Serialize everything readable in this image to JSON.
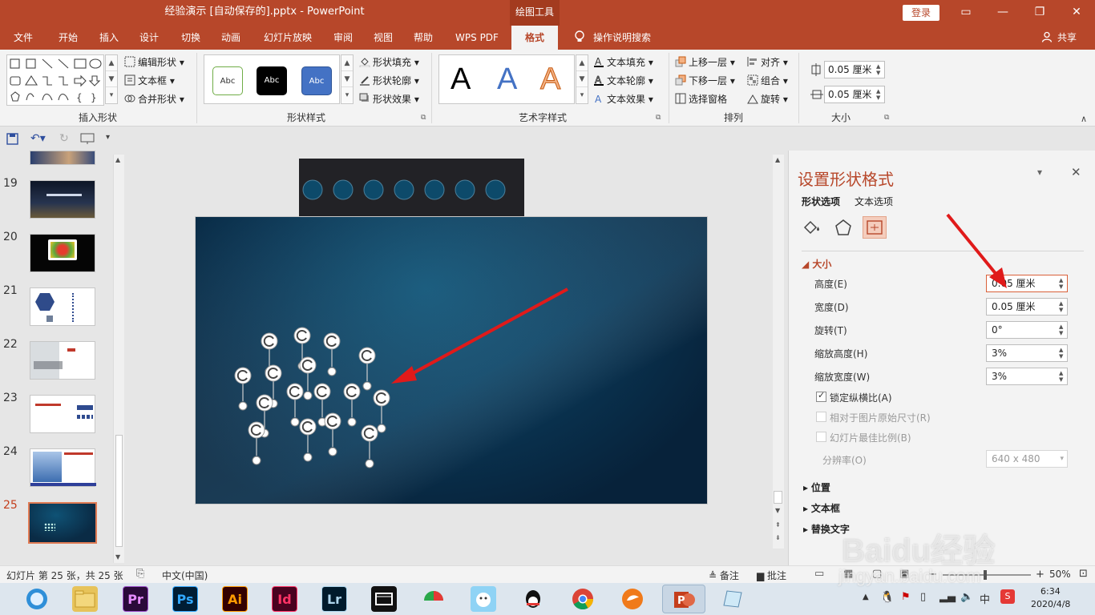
{
  "window": {
    "title": "经验演示 [自动保存的].pptx  -  PowerPoint",
    "context_group": "绘图工具",
    "login_label": "登录",
    "share_label": "共享",
    "tell_me": "操作说明搜索"
  },
  "tabs": [
    "文件",
    "开始",
    "插入",
    "设计",
    "切换",
    "动画",
    "幻灯片放映",
    "审阅",
    "视图",
    "帮助",
    "WPS PDF",
    "格式"
  ],
  "active_tab": "格式",
  "ribbon": {
    "insert_shapes": {
      "label": "插入形状",
      "edit_shape": "编辑形状",
      "text_box": "文本框",
      "merge_shapes": "合并形状"
    },
    "shape_styles": {
      "label": "形状样式",
      "presets": [
        "Abc",
        "Abc",
        "Abc"
      ],
      "fill": "形状填充",
      "outline": "形状轮廓",
      "effects": "形状效果"
    },
    "wordart": {
      "label": "艺术字样式",
      "presets": [
        "A",
        "A",
        "A"
      ],
      "text_fill": "文本填充",
      "text_outline": "文本轮廓",
      "text_effects": "文本效果"
    },
    "arrange": {
      "label": "排列",
      "bring_forward": "上移一层",
      "send_backward": "下移一层",
      "selection_pane": "选择窗格",
      "align": "对齐",
      "group": "组合",
      "rotate": "旋转"
    },
    "size": {
      "label": "大小",
      "height": "0.05 厘米",
      "width": "0.05 厘米"
    }
  },
  "slides": {
    "visible_numbers": [
      "19",
      "20",
      "21",
      "22",
      "23",
      "24",
      "25"
    ],
    "current": "25"
  },
  "format_pane": {
    "title": "设置形状格式",
    "tabs": [
      "形状选项",
      "文本选项"
    ],
    "section_size": "大小",
    "height_label": "高度(E)",
    "height_value": "0.05 厘米",
    "width_label": "宽度(D)",
    "width_value": "0.05 厘米",
    "rotation_label": "旋转(T)",
    "rotation_value": "0°",
    "scale_height_label": "缩放高度(H)",
    "scale_height_value": "3%",
    "scale_width_label": "缩放宽度(W)",
    "scale_width_value": "3%",
    "lock_aspect": "锁定纵横比(A)",
    "relative_original": "相对于图片原始尺寸(R)",
    "best_scale": "幻灯片最佳比例(B)",
    "resolution_label": "分辨率(O)",
    "resolution_value": "640 x 480",
    "section_position": "位置",
    "section_textbox": "文本框",
    "section_alt_text": "替换文字"
  },
  "status": {
    "slide_info": "幻灯片 第 25 张，共 25 张",
    "language": "中文(中国)",
    "notes": "备注",
    "comments": "批注",
    "zoom": "50%"
  },
  "taskbar": {
    "apps": [
      "Pr",
      "Ps",
      "Ai",
      "Id",
      "Lr"
    ],
    "time": "6:34",
    "date": "2020/4/8",
    "ime": "中"
  },
  "watermark": "Baidu经验",
  "watermark_url": "jingyan.baidu.com"
}
